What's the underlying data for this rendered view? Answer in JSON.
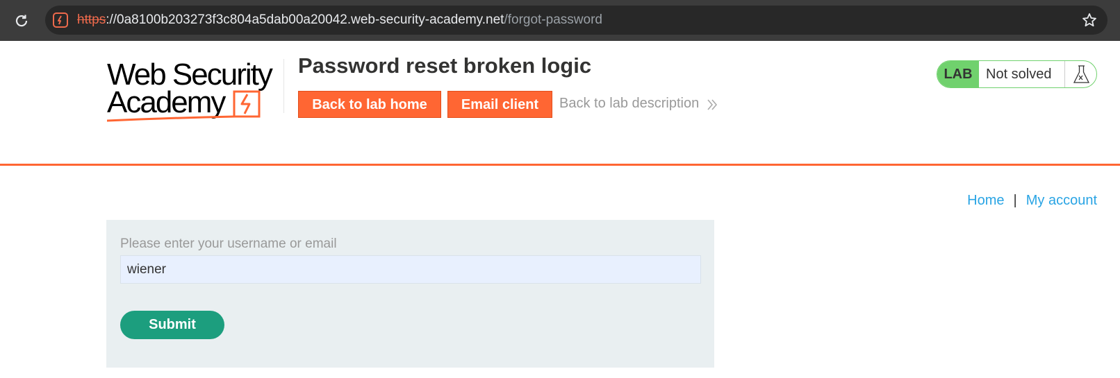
{
  "browser": {
    "url_scheme": "https",
    "url_host": "://0a8100b203273f3c804a5dab00a20042.web-security-academy.net",
    "url_path": "/forgot-password",
    "reload_icon": "reload-icon",
    "bookmark_icon": "star-icon"
  },
  "logo": {
    "line1": "Web Security",
    "line2": "Academy"
  },
  "lab": {
    "title": "Password reset broken logic",
    "back_home_label": "Back to lab home",
    "email_client_label": "Email client",
    "description_link": "Back to lab description",
    "badge_label": "LAB",
    "status": "Not solved",
    "status_icon": "flask-icon"
  },
  "nav": {
    "home": "Home",
    "separator": "|",
    "account": "My account"
  },
  "form": {
    "label": "Please enter your username or email",
    "value": "wiener",
    "submit_label": "Submit"
  },
  "colors": {
    "accent": "#ff6633",
    "link": "#29a4e4",
    "submit": "#1c9e7e",
    "badge_green": "#70d16d"
  }
}
